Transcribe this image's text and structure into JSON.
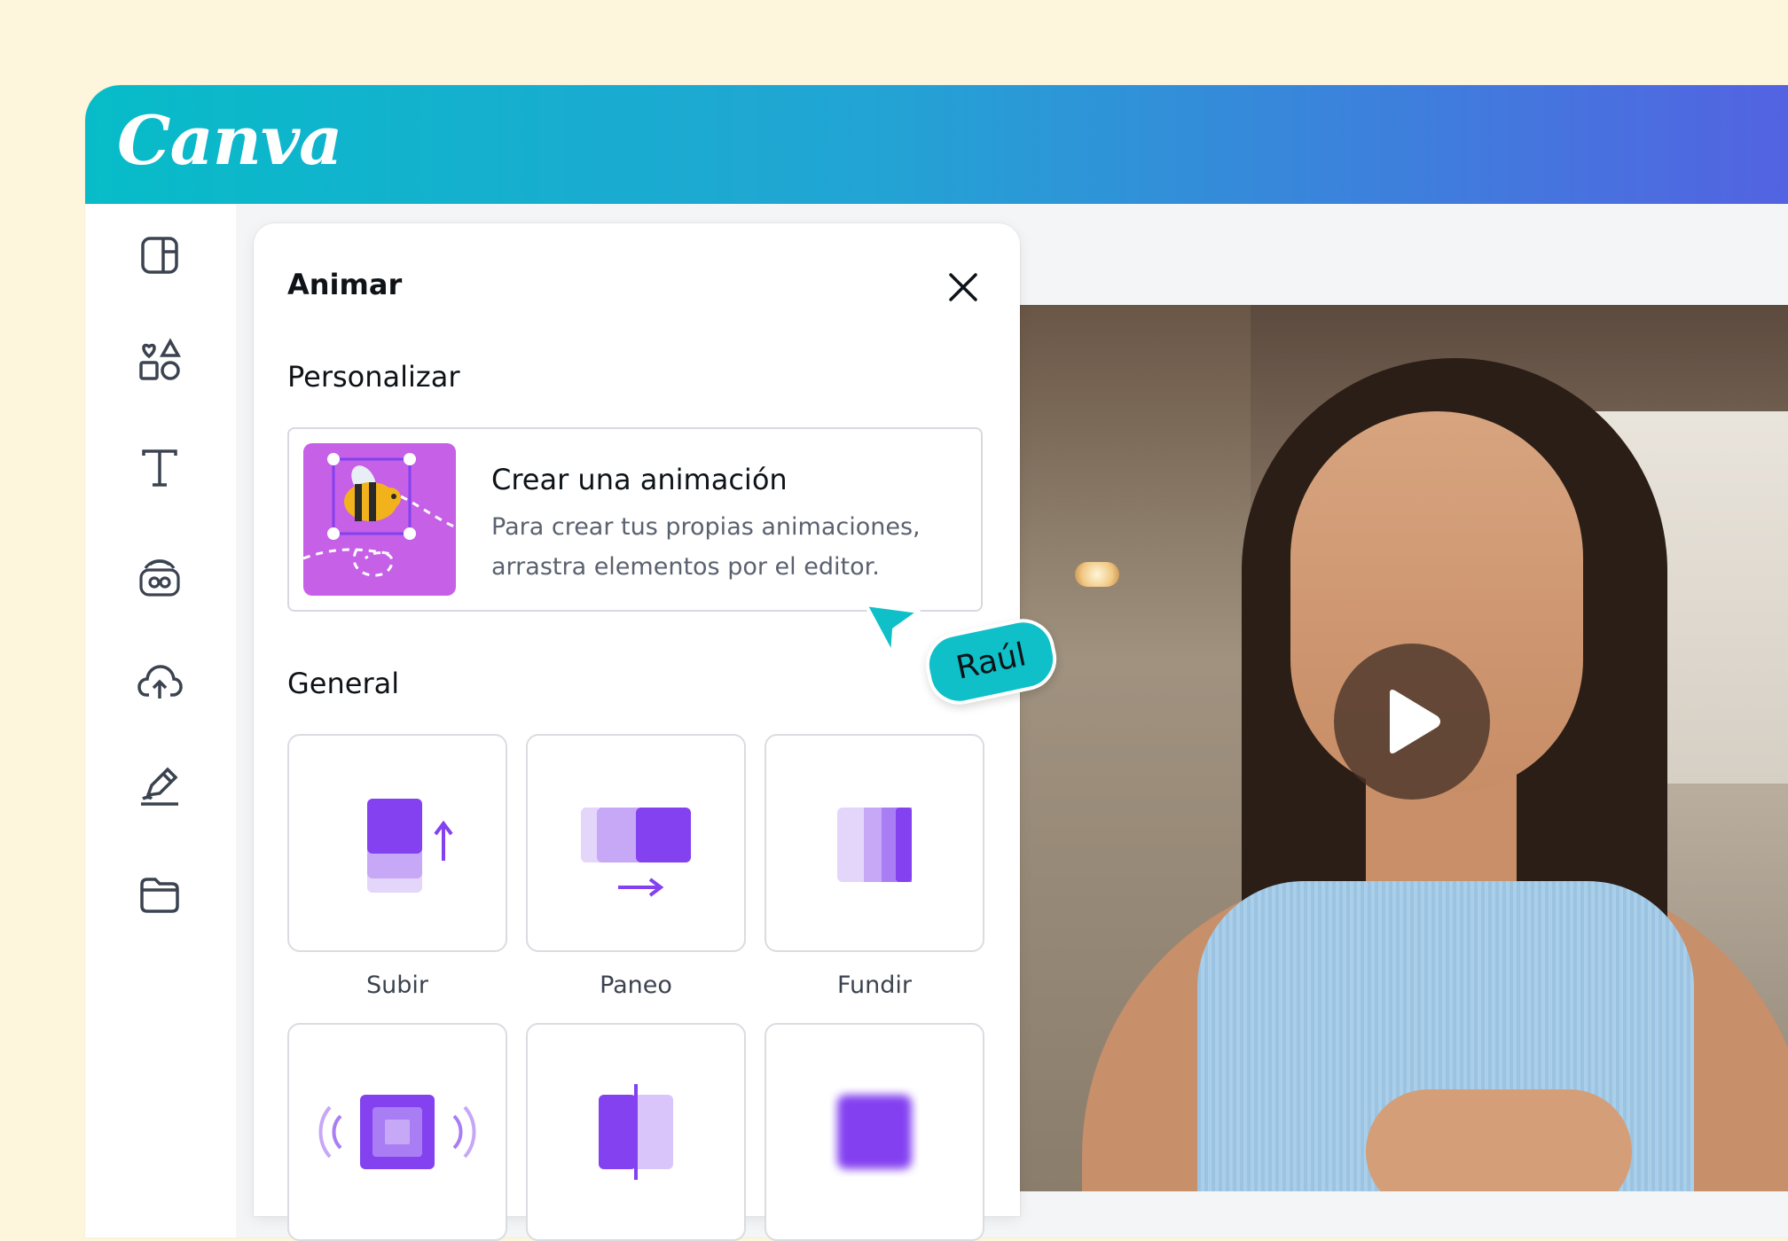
{
  "app": {
    "logo_text": "Canva",
    "accent_gradient": [
      "#07bcc8",
      "#5560e2"
    ]
  },
  "sidebar": {
    "items": [
      {
        "name": "layout-icon"
      },
      {
        "name": "elements-icon"
      },
      {
        "name": "text-icon"
      },
      {
        "name": "brand-icon"
      },
      {
        "name": "uploads-icon"
      },
      {
        "name": "draw-icon"
      },
      {
        "name": "projects-icon"
      }
    ]
  },
  "panel": {
    "title": "Animar",
    "personalize": {
      "heading": "Personalizar",
      "create_title": "Crear una animación",
      "create_desc": "Para crear tus propias animaciones, arrastra elementos por el editor."
    },
    "general": {
      "heading": "General",
      "tiles": [
        {
          "label": "Subir"
        },
        {
          "label": "Paneo"
        },
        {
          "label": "Fundir"
        },
        {
          "label": ""
        },
        {
          "label": ""
        },
        {
          "label": ""
        }
      ]
    }
  },
  "collaborator": {
    "name": "Raúl",
    "color": "#10c0c8"
  },
  "colors": {
    "purple": "#8341f0",
    "purple_light": "#c7a8f7",
    "thumb": "#c660e6"
  }
}
